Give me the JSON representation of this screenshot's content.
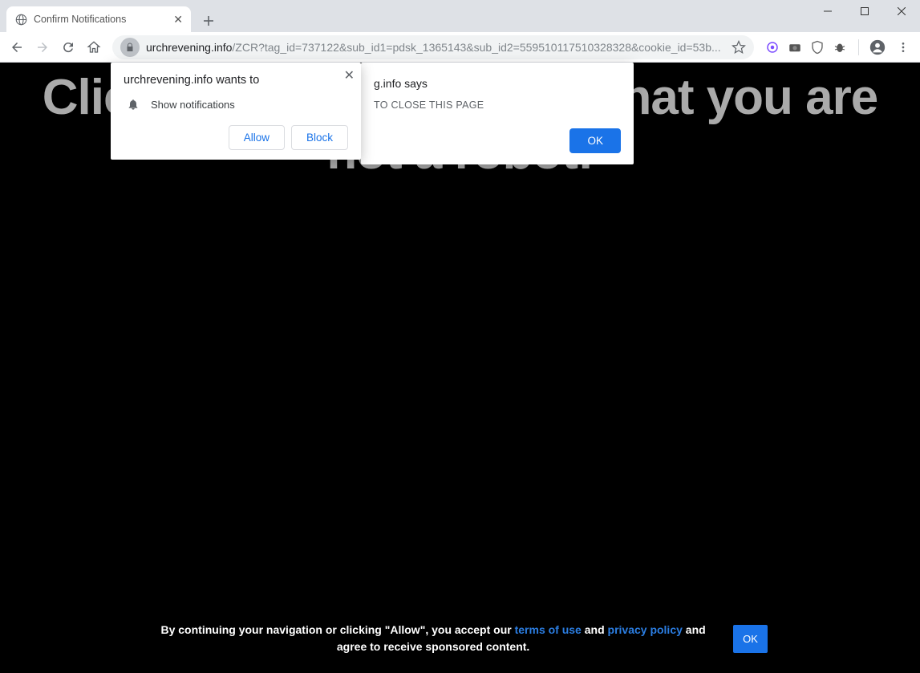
{
  "window": {
    "minimize": "—",
    "maximize": "▢",
    "close": "✕"
  },
  "tab": {
    "title": "Confirm Notifications",
    "close": "✕"
  },
  "toolbar": {
    "url_domain": "urchrevening.info",
    "url_path": "/ZCR?tag_id=737122&sub_id1=pdsk_1365143&sub_id2=559510117510328328&cookie_id=53b..."
  },
  "ext_icons": [
    "origin-icon",
    "camera-icon",
    "shield-icon",
    "bug-icon"
  ],
  "page": {
    "headline_full": "Click \"Allow\" to confirm that you are not a robot!",
    "headline_line2": "robot!"
  },
  "perm": {
    "title": "urchrevening.info wants to",
    "item": "Show notifications",
    "allow": "Allow",
    "block": "Block",
    "close": "✕"
  },
  "alert": {
    "title_suffix": "g.info says",
    "message": "TO CLOSE THIS PAGE",
    "ok": "OK"
  },
  "cookie": {
    "prefix": "By continuing your navigation or clicking \"Allow\", you accept our ",
    "terms": "terms of use",
    "and": " and ",
    "privacy": "privacy policy",
    "suffix": " and agree to receive sponsored content.",
    "ok": "OK"
  }
}
